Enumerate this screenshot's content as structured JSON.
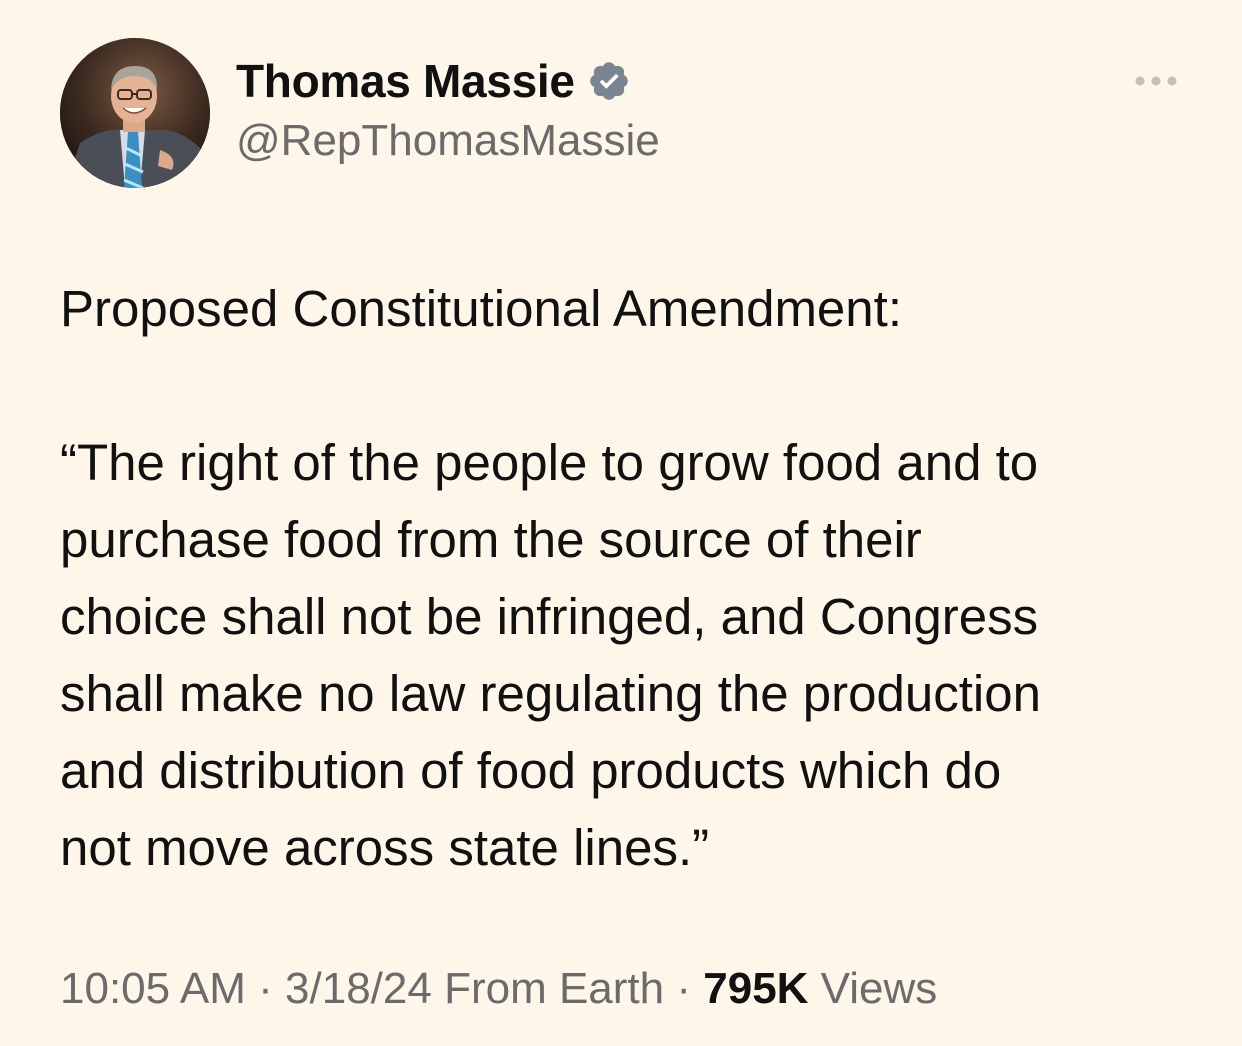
{
  "author": {
    "display_name": "Thomas Massie",
    "handle": "@RepThomasMassie",
    "verified": true
  },
  "tweet": {
    "heading": "Proposed Constitutional Amendment:",
    "quote_lines": [
      "“The right of the people to grow food and to",
      "purchase food from the source of their",
      "choice shall not be infringed, and Congress",
      "shall make no law regulating the production",
      "and distribution of food products which do",
      "not move across state lines.”"
    ]
  },
  "meta": {
    "time": "10:05 AM",
    "separator": "·",
    "date": "3/18/24",
    "source": "From Earth",
    "views_count": "795K",
    "views_label": "Views"
  },
  "icons": {
    "more": "more-options-icon",
    "verified": "verified-badge-icon"
  },
  "colors": {
    "background": "#fdf6e9",
    "text": "#111111",
    "secondary_text": "#6b6b6b",
    "verified_badge": "#7a8592"
  }
}
